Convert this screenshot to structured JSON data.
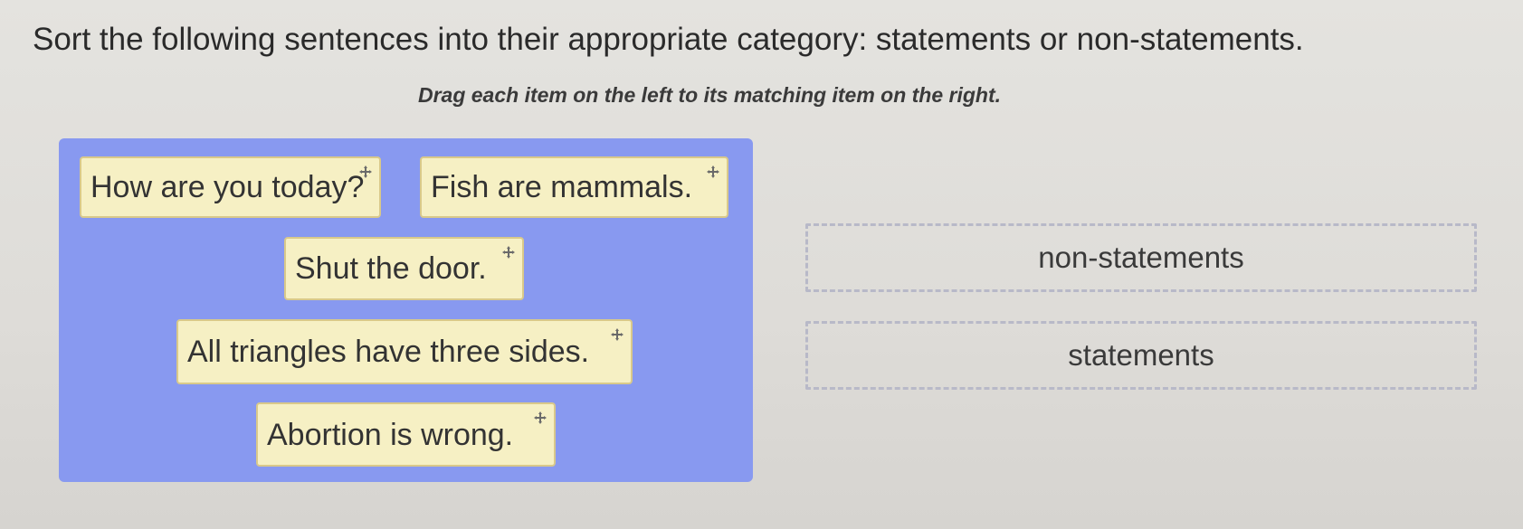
{
  "question": {
    "text": "Sort the following sentences into their appropriate category: statements or non-statements.",
    "instruction": "Drag each item on the left to its matching item on the right."
  },
  "items": [
    {
      "label": "How are you today?"
    },
    {
      "label": "Fish are mammals."
    },
    {
      "label": "Shut the door."
    },
    {
      "label": "All triangles have three sides."
    },
    {
      "label": "Abortion is wrong."
    }
  ],
  "targets": [
    {
      "label": "non-statements"
    },
    {
      "label": "statements"
    }
  ],
  "colors": {
    "panel": "#8899f0",
    "item_bg": "#f6f0c4",
    "item_border": "#d9c98a",
    "target_border": "#b8b9c8"
  },
  "icons": {
    "drag_handle": "move-icon"
  }
}
